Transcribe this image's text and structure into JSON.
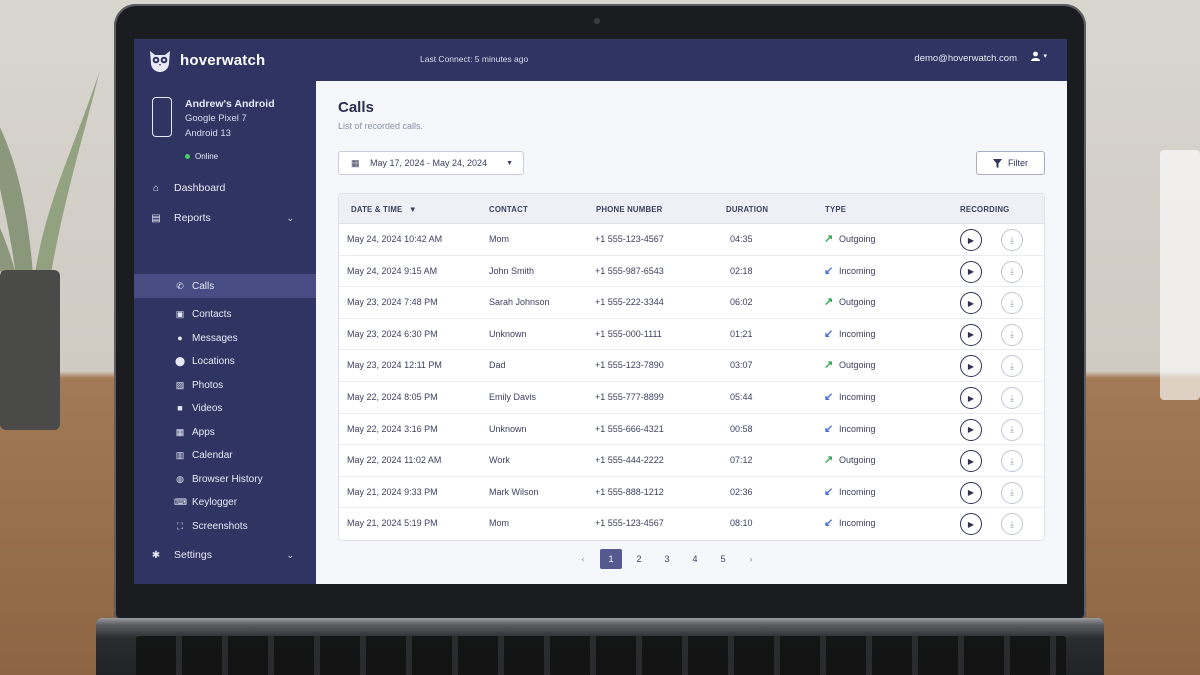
{
  "header": {
    "brand": "hoverwatch",
    "last_connect": "Last Connect: 5 minutes ago",
    "user_email": "demo@hoverwatch.com"
  },
  "device": {
    "name": "Andrew's Android",
    "model": "Google Pixel 7",
    "os": "Android 13",
    "status": "Online"
  },
  "sidebar": {
    "dashboard": "Dashboard",
    "reports": "Reports",
    "settings": "Settings",
    "sub_items": [
      "Calls",
      "Contacts",
      "Messages",
      "Locations",
      "Photos",
      "Videos",
      "Apps",
      "Calendar",
      "Browser History",
      "Keylogger",
      "Screenshots"
    ],
    "active": "Calls"
  },
  "page": {
    "title": "Calls",
    "subtitle": "List of recorded calls.",
    "date_range": "May 17, 2024 - May 24, 2024",
    "filter_label": "Filter"
  },
  "table": {
    "headers": {
      "datetime": "DATE & TIME",
      "contact": "CONTACT",
      "phone": "PHONE NUMBER",
      "duration": "DURATION",
      "type": "TYPE",
      "recording": "RECORDING"
    },
    "rows": [
      {
        "date": "May 24, 2024",
        "time": "10:42 AM",
        "contact": "Mom",
        "phone": "+1 555-123-4567",
        "duration": "04:35",
        "type": "Outgoing"
      },
      {
        "date": "May 24, 2024",
        "time": "9:15 AM",
        "contact": "John Smith",
        "phone": "+1 555-987-6543",
        "duration": "02:18",
        "type": "Incoming"
      },
      {
        "date": "May 23, 2024",
        "time": "7:48 PM",
        "contact": "Sarah Johnson",
        "phone": "+1 555-222-3344",
        "duration": "06:02",
        "type": "Outgoing"
      },
      {
        "date": "May 23, 2024",
        "time": "6:30 PM",
        "contact": "Unknown",
        "phone": "+1 555-000-1111",
        "duration": "01:21",
        "type": "Incoming"
      },
      {
        "date": "May 23, 2024",
        "time": "12:11 PM",
        "contact": "Dad",
        "phone": "+1 555-123-7890",
        "duration": "03:07",
        "type": "Outgoing"
      },
      {
        "date": "May 22, 2024",
        "time": "8:05 PM",
        "contact": "Emily Davis",
        "phone": "+1 555-777-8899",
        "duration": "05:44",
        "type": "Incoming"
      },
      {
        "date": "May 22, 2024",
        "time": "3:16 PM",
        "contact": "Unknown",
        "phone": "+1 555-666-4321",
        "duration": "00:58",
        "type": "Incoming"
      },
      {
        "date": "May 22, 2024",
        "time": "11:02 AM",
        "contact": "Work",
        "phone": "+1 555-444-2222",
        "duration": "07:12",
        "type": "Outgoing"
      },
      {
        "date": "May 21, 2024",
        "time": "9:33 PM",
        "contact": "Mark Wilson",
        "phone": "+1 555-888-1212",
        "duration": "02:36",
        "type": "Incoming"
      },
      {
        "date": "May 21, 2024",
        "time": "5:19 PM",
        "contact": "Mom",
        "phone": "+1 555-123-4567",
        "duration": "08:10",
        "type": "Incoming"
      }
    ]
  },
  "pagination": {
    "pages": [
      "1",
      "2",
      "3",
      "4",
      "5"
    ],
    "current": "1",
    "prev": "‹",
    "next": "›"
  },
  "colors": {
    "sidebar_bg": "#2f3463",
    "active_item": "#474c82",
    "outgoing_arrow": "#35a853",
    "incoming_arrow": "#4a6fd8",
    "page_active": "#54598f"
  },
  "icons": {
    "outgoing": "↗",
    "incoming": "↙",
    "play": "▶",
    "download": "⤓"
  }
}
